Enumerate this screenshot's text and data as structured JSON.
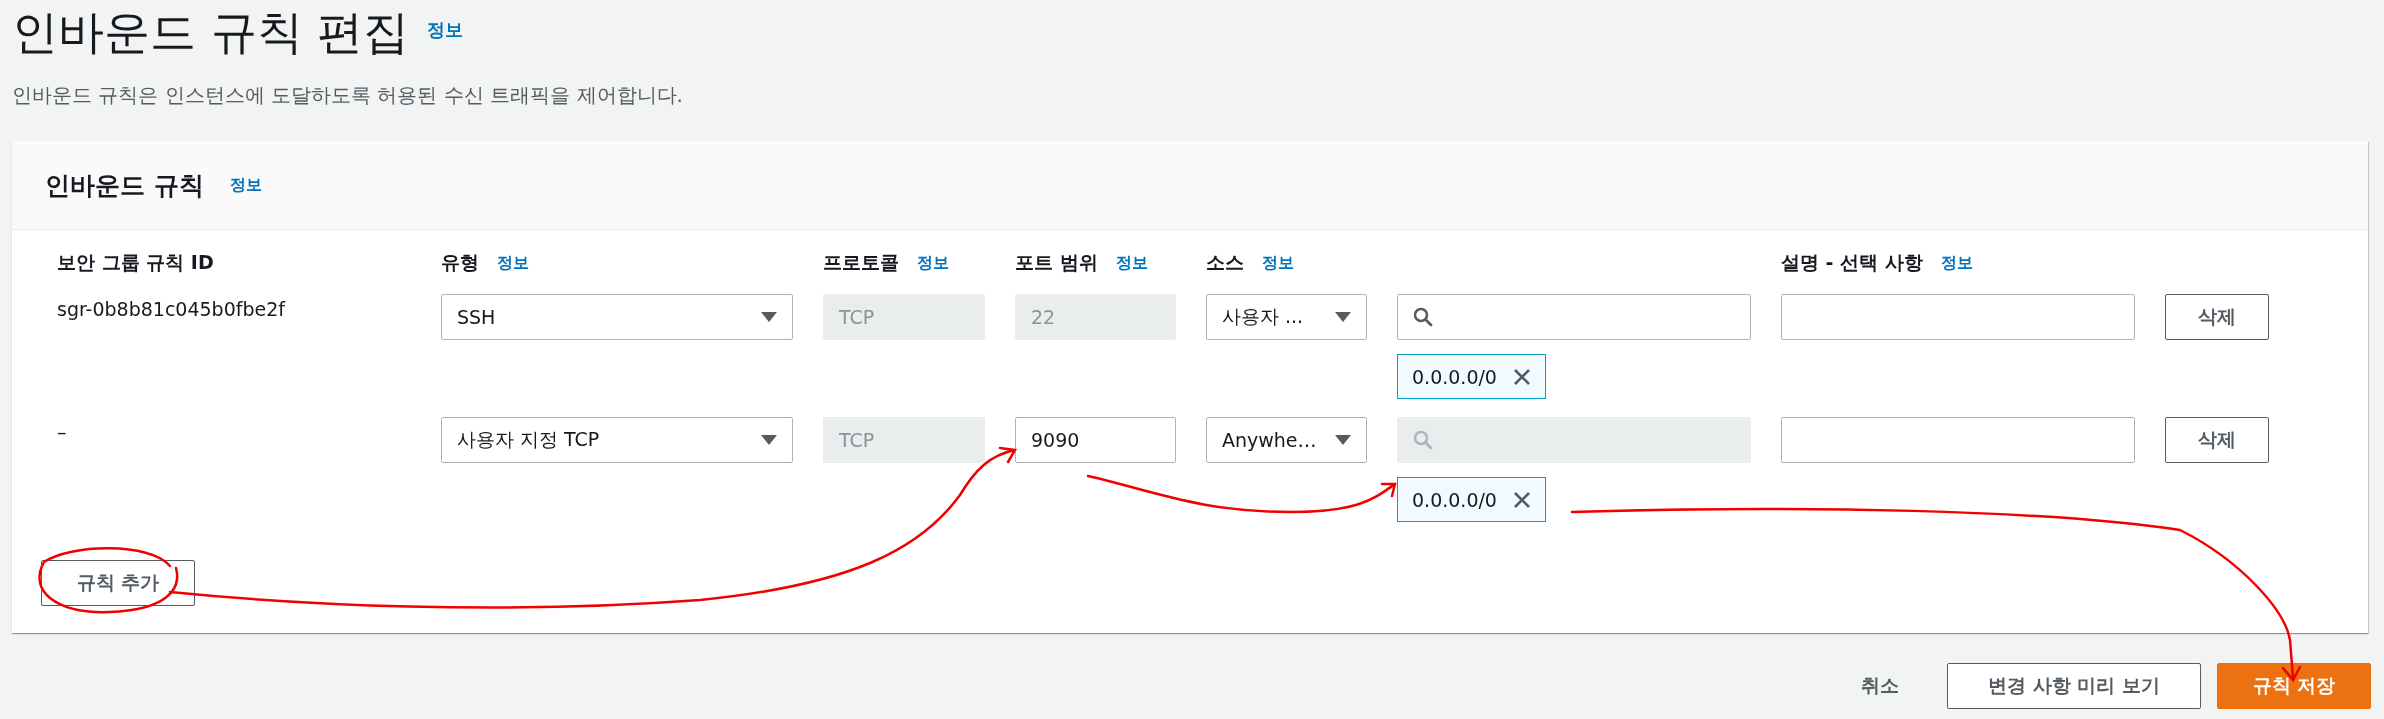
{
  "page": {
    "title": "인바운드 규칙 편집",
    "title_info": "정보",
    "description": "인바운드 규칙은 인스턴스에 도달하도록 허용된 수신 트래픽을 제어합니다."
  },
  "panel": {
    "title": "인바운드 규칙",
    "info": "정보",
    "columns": [
      {
        "label": "보안 그룹 규칙 ID"
      },
      {
        "label": "유형",
        "info": "정보"
      },
      {
        "label": "프로토콜",
        "info": "정보"
      },
      {
        "label": "포트 범위",
        "info": "정보"
      },
      {
        "label": "소스",
        "info": "정보"
      },
      {
        "label": "설명 - 선택 사항",
        "info": "정보"
      }
    ],
    "rules": [
      {
        "id": "sgr-0b8b81c045b0fbe2f",
        "type": "SSH",
        "protocol": "TCP",
        "port": "22",
        "port_disabled": true,
        "source": "사용자 ...",
        "search_disabled": false,
        "cidr": "0.0.0.0/0",
        "delete": "삭제"
      },
      {
        "id": "–",
        "type": "사용자 지정 TCP",
        "protocol": "TCP",
        "port": "9090",
        "port_disabled": false,
        "source": "Anywhe…",
        "search_disabled": true,
        "cidr": "0.0.0.0/0",
        "delete": "삭제"
      }
    ],
    "add_button": "규칙 추가"
  },
  "footer": {
    "cancel": "취소",
    "preview": "변경 사항 미리 보기",
    "save": "규칙 저장"
  }
}
